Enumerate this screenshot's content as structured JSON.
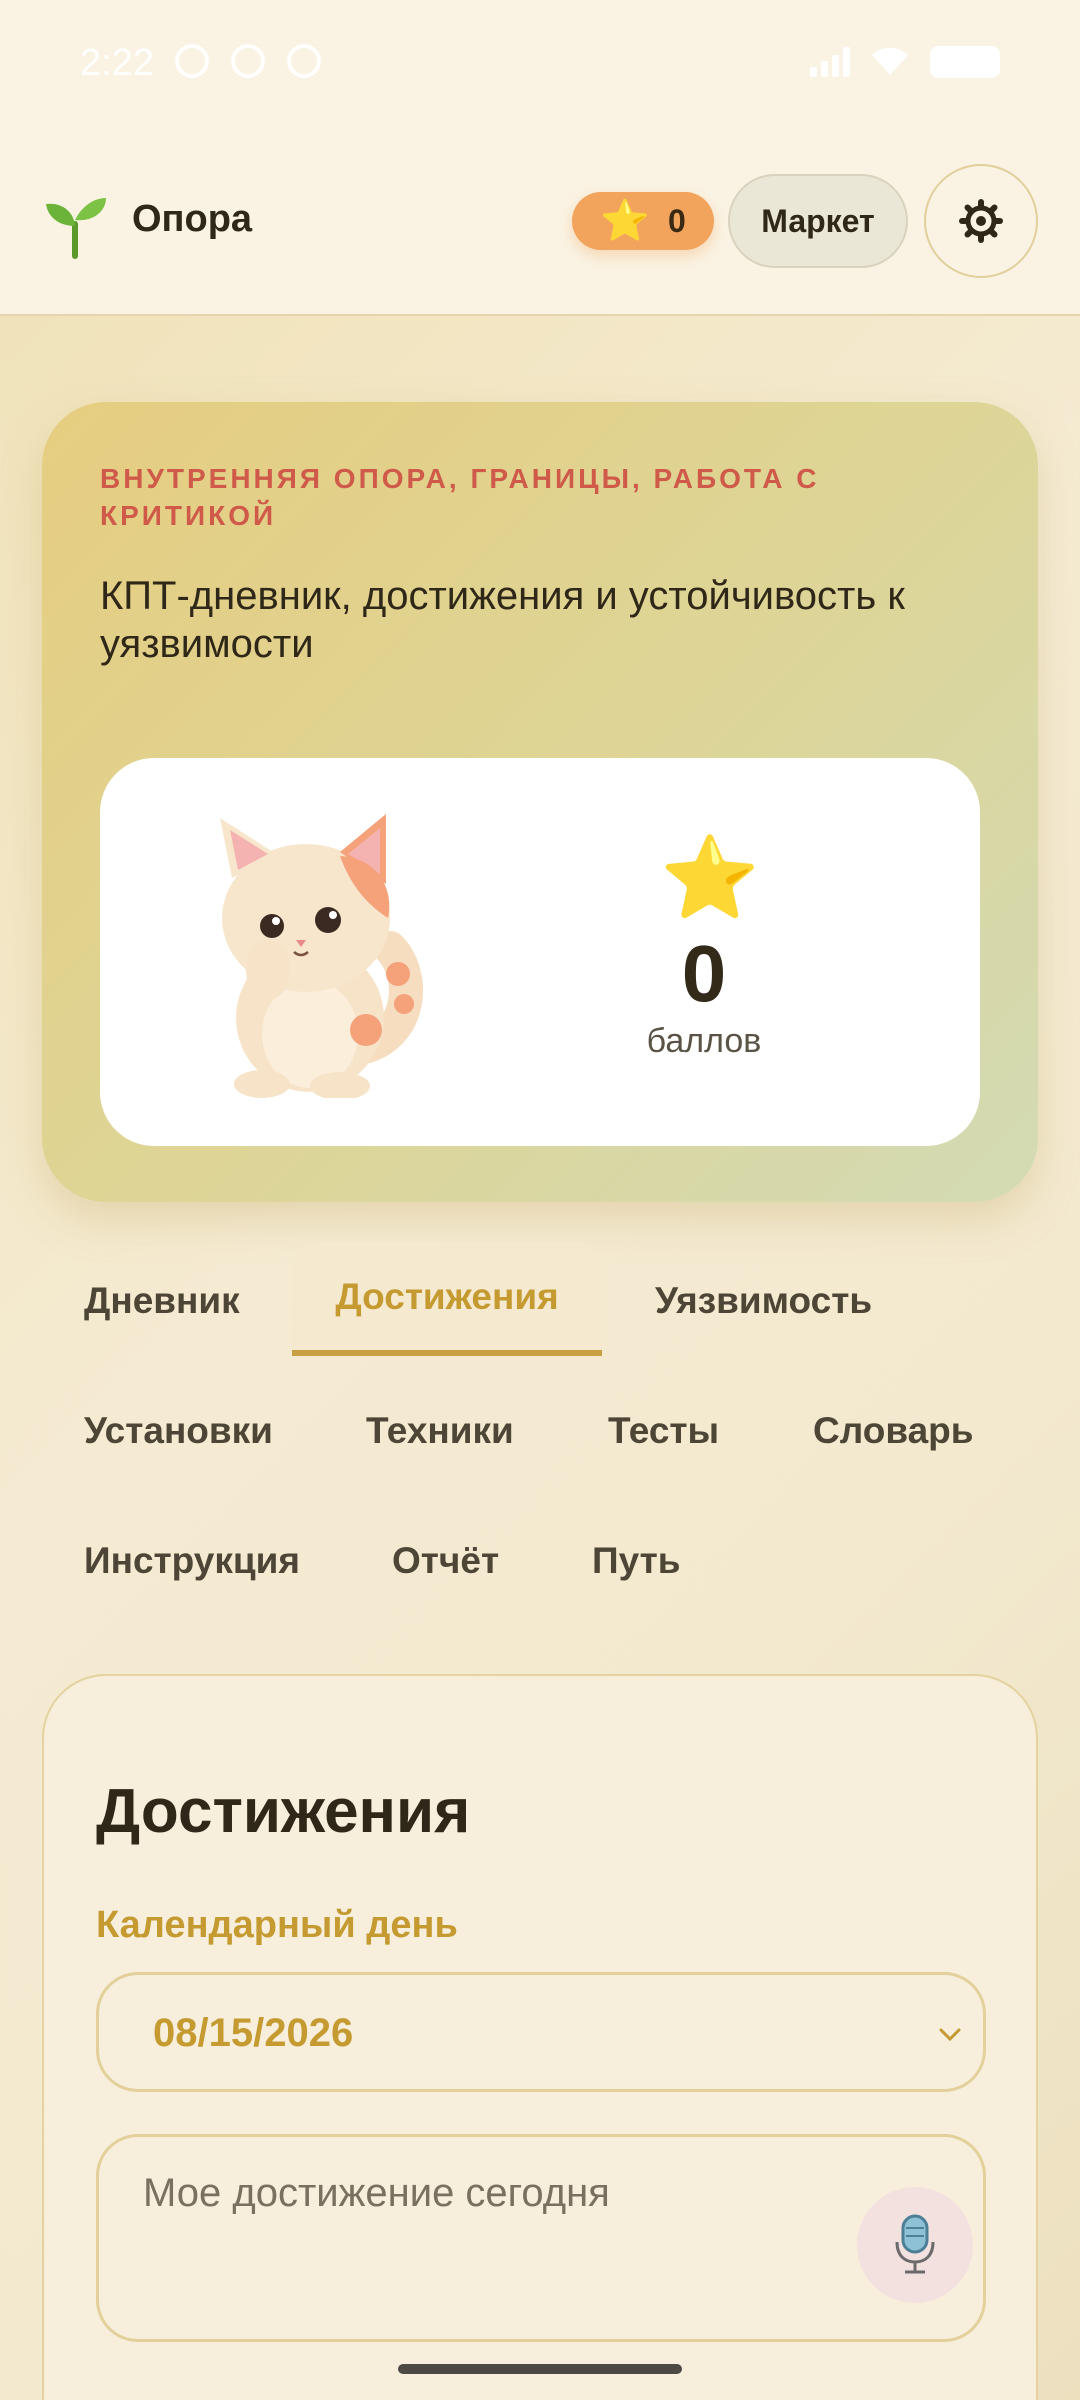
{
  "status_bar": {
    "time": "2:22"
  },
  "header": {
    "app_title": "Опора",
    "logo_icon": "seedling-icon",
    "points": "0",
    "points_icon": "star-icon",
    "market_label": "Маркет",
    "settings_icon": "gear-icon"
  },
  "hero": {
    "eyebrow": "ВНУТРЕННЯЯ ОПОРА, ГРАНИЦЫ, РАБОТА С КРИТИКОЙ",
    "subtitle": "КПТ-дневник, достижения и устойчивость к уязвимости",
    "mascot_icon": "cat-mascot-icon",
    "score_icon": "star-icon",
    "score_value": "0",
    "score_label": "баллов"
  },
  "tabs": [
    {
      "label": "Дневник",
      "active": false
    },
    {
      "label": "Достижения",
      "active": true
    },
    {
      "label": "Уязвимость",
      "active": false
    },
    {
      "label": "Установки",
      "active": false
    },
    {
      "label": "Техники",
      "active": false
    },
    {
      "label": "Тесты",
      "active": false
    },
    {
      "label": "Словарь",
      "active": false
    },
    {
      "label": "Инструкция",
      "active": false
    },
    {
      "label": "Отчёт",
      "active": false
    },
    {
      "label": "Путь",
      "active": false
    }
  ],
  "form": {
    "title": "Достижения",
    "date_label": "Календарный день",
    "date_value": "08/15/2026",
    "achievement_placeholder": "Мое достижение сегодня",
    "mic_icon": "microphone-icon"
  },
  "colors": {
    "accent": "#c49a31",
    "eyebrow": "#cf5a49",
    "points_pill": "#f2a35c"
  }
}
